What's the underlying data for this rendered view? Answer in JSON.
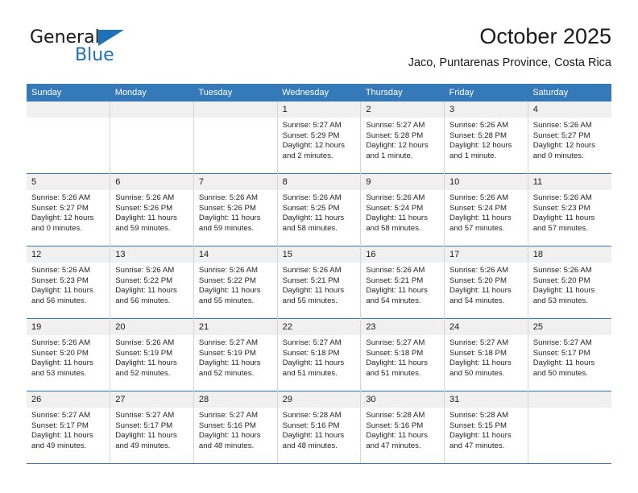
{
  "brand": {
    "line1": "General",
    "line2": "Blue",
    "triangle_icon": "triangle-icon"
  },
  "header": {
    "title": "October 2025",
    "subtitle": "Jaco, Puntarenas Province, Costa Rica"
  },
  "colors": {
    "header_blue": "#3579b8",
    "brand_blue": "#1d71b8",
    "daynum_bg": "#f0f0f0",
    "cell_border": "#d4d4d4",
    "text": "#1a1a1a"
  },
  "calendar": {
    "weekdays": [
      "Sunday",
      "Monday",
      "Tuesday",
      "Wednesday",
      "Thursday",
      "Friday",
      "Saturday"
    ],
    "weeks": [
      [
        {
          "day": "",
          "lines": []
        },
        {
          "day": "",
          "lines": []
        },
        {
          "day": "",
          "lines": []
        },
        {
          "day": "1",
          "lines": [
            "Sunrise: 5:27 AM",
            "Sunset: 5:29 PM",
            "Daylight: 12 hours and 2 minutes."
          ]
        },
        {
          "day": "2",
          "lines": [
            "Sunrise: 5:27 AM",
            "Sunset: 5:28 PM",
            "Daylight: 12 hours and 1 minute."
          ]
        },
        {
          "day": "3",
          "lines": [
            "Sunrise: 5:26 AM",
            "Sunset: 5:28 PM",
            "Daylight: 12 hours and 1 minute."
          ]
        },
        {
          "day": "4",
          "lines": [
            "Sunrise: 5:26 AM",
            "Sunset: 5:27 PM",
            "Daylight: 12 hours and 0 minutes."
          ]
        }
      ],
      [
        {
          "day": "5",
          "lines": [
            "Sunrise: 5:26 AM",
            "Sunset: 5:27 PM",
            "Daylight: 12 hours and 0 minutes."
          ]
        },
        {
          "day": "6",
          "lines": [
            "Sunrise: 5:26 AM",
            "Sunset: 5:26 PM",
            "Daylight: 11 hours and 59 minutes."
          ]
        },
        {
          "day": "7",
          "lines": [
            "Sunrise: 5:26 AM",
            "Sunset: 5:26 PM",
            "Daylight: 11 hours and 59 minutes."
          ]
        },
        {
          "day": "8",
          "lines": [
            "Sunrise: 5:26 AM",
            "Sunset: 5:25 PM",
            "Daylight: 11 hours and 58 minutes."
          ]
        },
        {
          "day": "9",
          "lines": [
            "Sunrise: 5:26 AM",
            "Sunset: 5:24 PM",
            "Daylight: 11 hours and 58 minutes."
          ]
        },
        {
          "day": "10",
          "lines": [
            "Sunrise: 5:26 AM",
            "Sunset: 5:24 PM",
            "Daylight: 11 hours and 57 minutes."
          ]
        },
        {
          "day": "11",
          "lines": [
            "Sunrise: 5:26 AM",
            "Sunset: 5:23 PM",
            "Daylight: 11 hours and 57 minutes."
          ]
        }
      ],
      [
        {
          "day": "12",
          "lines": [
            "Sunrise: 5:26 AM",
            "Sunset: 5:23 PM",
            "Daylight: 11 hours and 56 minutes."
          ]
        },
        {
          "day": "13",
          "lines": [
            "Sunrise: 5:26 AM",
            "Sunset: 5:22 PM",
            "Daylight: 11 hours and 56 minutes."
          ]
        },
        {
          "day": "14",
          "lines": [
            "Sunrise: 5:26 AM",
            "Sunset: 5:22 PM",
            "Daylight: 11 hours and 55 minutes."
          ]
        },
        {
          "day": "15",
          "lines": [
            "Sunrise: 5:26 AM",
            "Sunset: 5:21 PM",
            "Daylight: 11 hours and 55 minutes."
          ]
        },
        {
          "day": "16",
          "lines": [
            "Sunrise: 5:26 AM",
            "Sunset: 5:21 PM",
            "Daylight: 11 hours and 54 minutes."
          ]
        },
        {
          "day": "17",
          "lines": [
            "Sunrise: 5:26 AM",
            "Sunset: 5:20 PM",
            "Daylight: 11 hours and 54 minutes."
          ]
        },
        {
          "day": "18",
          "lines": [
            "Sunrise: 5:26 AM",
            "Sunset: 5:20 PM",
            "Daylight: 11 hours and 53 minutes."
          ]
        }
      ],
      [
        {
          "day": "19",
          "lines": [
            "Sunrise: 5:26 AM",
            "Sunset: 5:20 PM",
            "Daylight: 11 hours and 53 minutes."
          ]
        },
        {
          "day": "20",
          "lines": [
            "Sunrise: 5:26 AM",
            "Sunset: 5:19 PM",
            "Daylight: 11 hours and 52 minutes."
          ]
        },
        {
          "day": "21",
          "lines": [
            "Sunrise: 5:27 AM",
            "Sunset: 5:19 PM",
            "Daylight: 11 hours and 52 minutes."
          ]
        },
        {
          "day": "22",
          "lines": [
            "Sunrise: 5:27 AM",
            "Sunset: 5:18 PM",
            "Daylight: 11 hours and 51 minutes."
          ]
        },
        {
          "day": "23",
          "lines": [
            "Sunrise: 5:27 AM",
            "Sunset: 5:18 PM",
            "Daylight: 11 hours and 51 minutes."
          ]
        },
        {
          "day": "24",
          "lines": [
            "Sunrise: 5:27 AM",
            "Sunset: 5:18 PM",
            "Daylight: 11 hours and 50 minutes."
          ]
        },
        {
          "day": "25",
          "lines": [
            "Sunrise: 5:27 AM",
            "Sunset: 5:17 PM",
            "Daylight: 11 hours and 50 minutes."
          ]
        }
      ],
      [
        {
          "day": "26",
          "lines": [
            "Sunrise: 5:27 AM",
            "Sunset: 5:17 PM",
            "Daylight: 11 hours and 49 minutes."
          ]
        },
        {
          "day": "27",
          "lines": [
            "Sunrise: 5:27 AM",
            "Sunset: 5:17 PM",
            "Daylight: 11 hours and 49 minutes."
          ]
        },
        {
          "day": "28",
          "lines": [
            "Sunrise: 5:27 AM",
            "Sunset: 5:16 PM",
            "Daylight: 11 hours and 48 minutes."
          ]
        },
        {
          "day": "29",
          "lines": [
            "Sunrise: 5:28 AM",
            "Sunset: 5:16 PM",
            "Daylight: 11 hours and 48 minutes."
          ]
        },
        {
          "day": "30",
          "lines": [
            "Sunrise: 5:28 AM",
            "Sunset: 5:16 PM",
            "Daylight: 11 hours and 47 minutes."
          ]
        },
        {
          "day": "31",
          "lines": [
            "Sunrise: 5:28 AM",
            "Sunset: 5:15 PM",
            "Daylight: 11 hours and 47 minutes."
          ]
        },
        {
          "day": "",
          "lines": []
        }
      ]
    ]
  }
}
